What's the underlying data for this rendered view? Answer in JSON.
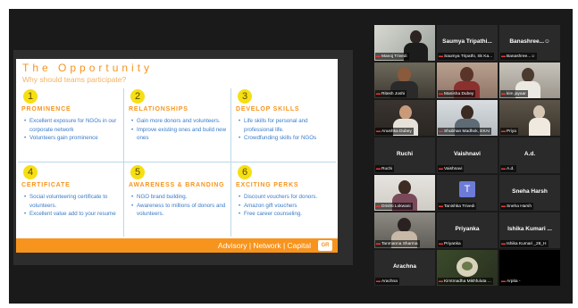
{
  "slide": {
    "title": "The Opportunity",
    "subtitle": "Why should teams participate?",
    "cards": [
      {
        "num": "1",
        "heading": "PROMINENCE",
        "bullets": [
          "Excellent exposure for NGOs in our corporate network",
          "Volunteers gain prominence"
        ]
      },
      {
        "num": "2",
        "heading": "RELATIONSHIPS",
        "bullets": [
          "Gain more donors and volunteers.",
          "Improve existing ones and build new ones"
        ]
      },
      {
        "num": "3",
        "heading": "DEVELOP SKILLS",
        "bullets": [
          "Life skills for personal and professional life.",
          "Crowdfunding skills for NGOs"
        ]
      },
      {
        "num": "4",
        "heading": "CERTIFICATE",
        "bullets": [
          "Social volunteering certificate to volunteers.",
          "Excellent value add to your resume"
        ]
      },
      {
        "num": "5",
        "heading": "AWARENESS & BRANDING",
        "bullets": [
          "NGO brand building.",
          "Awareness to millions of donors and volunteers."
        ]
      },
      {
        "num": "6",
        "heading": "EXCITING PERKS",
        "bullets": [
          "Discount vouchers for donors.",
          "Amazon gift vouchers",
          "Free career counseling."
        ]
      }
    ],
    "footer": "Advisory | Network | Capital",
    "logo_text": "GR"
  },
  "participants": [
    {
      "label": "Manoj Trivedi",
      "name": "",
      "video": true
    },
    {
      "label": "Saumya Tripathi, Sk Ka...",
      "name": "Saumya  Tripathi...",
      "video": false
    },
    {
      "label": "Banashree...☺",
      "name": "Banashree...☺",
      "video": false
    },
    {
      "label": "Ritesh Joshi",
      "name": "",
      "video": true,
      "speaking": true
    },
    {
      "label": "Manisha Dubey",
      "name": "",
      "video": true
    },
    {
      "label": "kim jayaar",
      "name": "",
      "video": true
    },
    {
      "label": "Anushka Dubey",
      "name": "",
      "video": true
    },
    {
      "label": "Shubhan Madhok, EKAI",
      "name": "",
      "video": true
    },
    {
      "label": "Priya",
      "name": "",
      "video": true
    },
    {
      "label": "Ruchi",
      "name": "Ruchi",
      "video": false
    },
    {
      "label": "Vaishnavi",
      "name": "Vaishnavi",
      "video": false
    },
    {
      "label": "A.d.",
      "name": "A.d.",
      "video": false
    },
    {
      "label": "Drishti Lokwani",
      "name": "",
      "video": true
    },
    {
      "label": "Tanishka Trivedi",
      "name": "",
      "avatar": "T",
      "video": false
    },
    {
      "label": "Sneha Harsh",
      "name": "Sneha Harsh",
      "video": false
    },
    {
      "label": "Tanmanna Sharma",
      "name": "",
      "video": true
    },
    {
      "label": "Priyanka",
      "name": "Priyanka",
      "video": false
    },
    {
      "label": "Ishika Kumari _28_H",
      "name": "Ishika  Kumari  ...",
      "video": false
    },
    {
      "label": "Arachna",
      "name": "Arachna",
      "video": false
    },
    {
      "label": "Kimtmadha Mikhfuluta ...",
      "name": "",
      "video": true
    },
    {
      "label": "Arpita -",
      "name": "",
      "video": true
    }
  ]
}
